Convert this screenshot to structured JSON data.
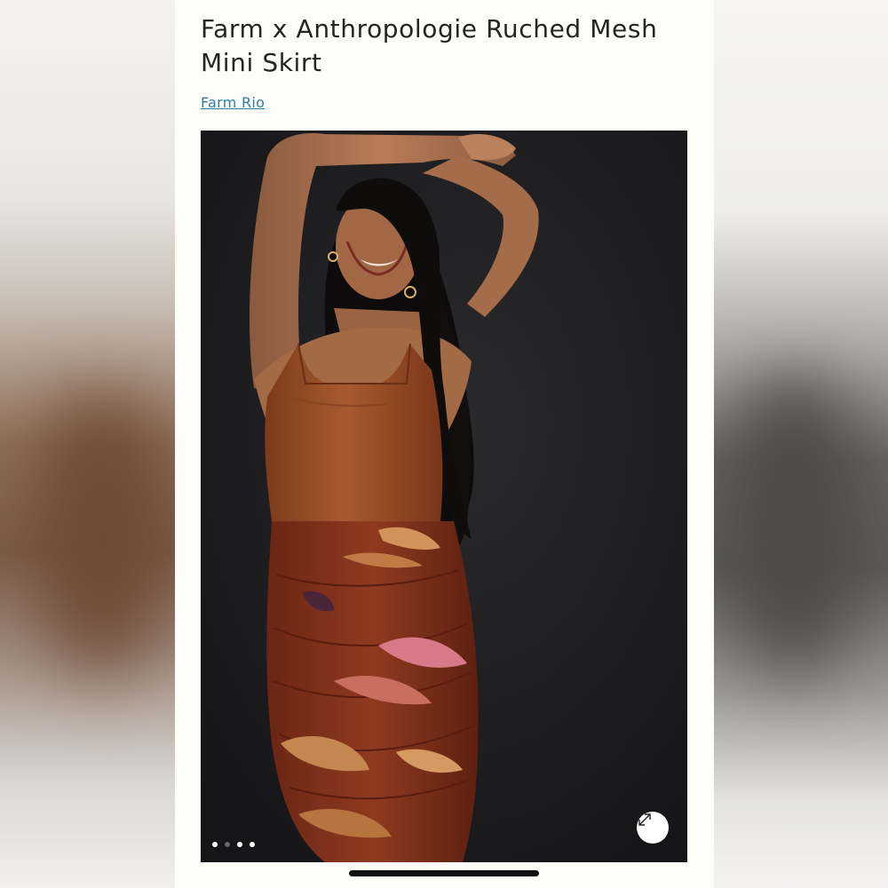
{
  "product": {
    "title": "Farm x Anthropologie Ruched Mesh Mini Skirt",
    "brand_link": "Farm Rio"
  },
  "gallery": {
    "slide_count": 4,
    "active_slide": 1,
    "expand_icon": "expand-arrows-icon"
  },
  "colors": {
    "link": "#2f7ea6",
    "title": "#242424",
    "page_background": "#fcfcf8",
    "photo_background": "#1c1c1e"
  }
}
